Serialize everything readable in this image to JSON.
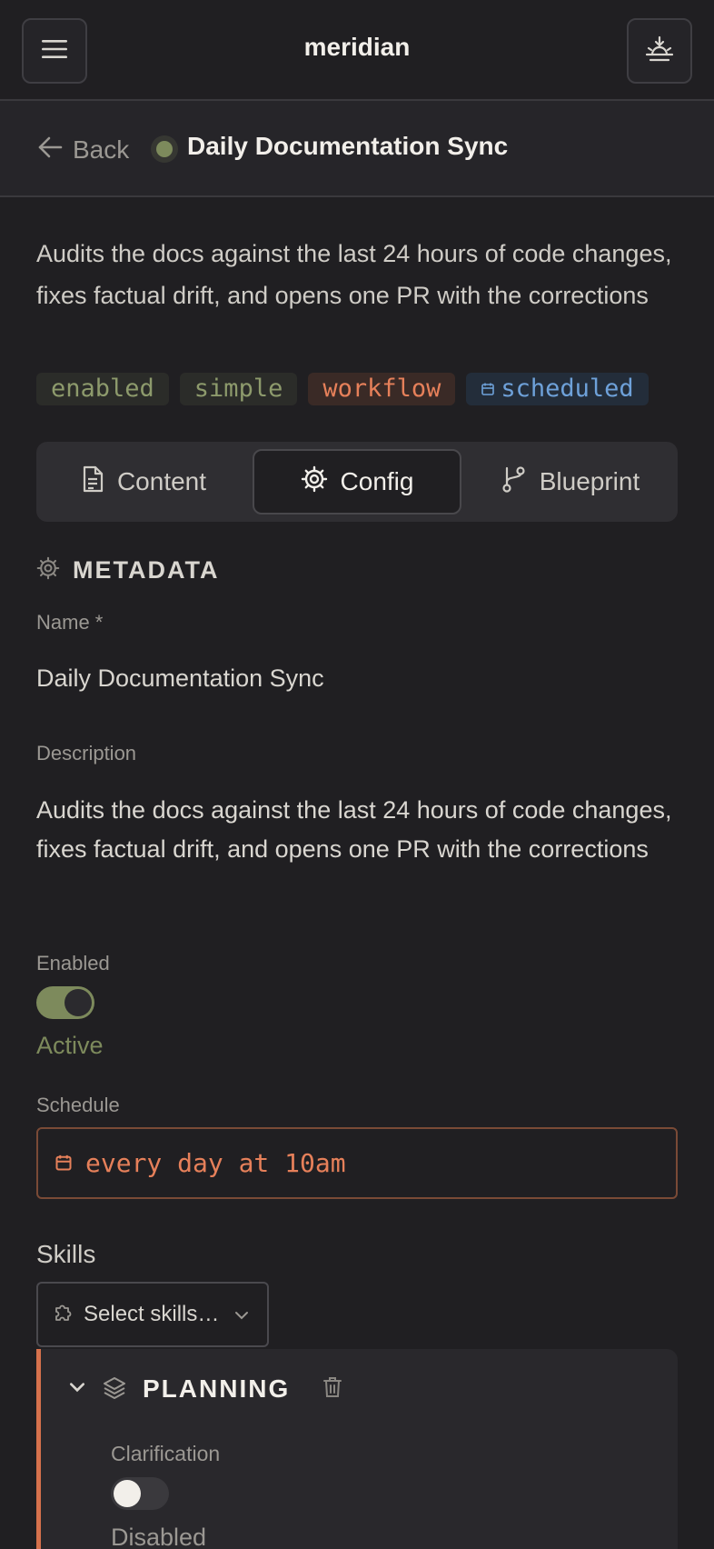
{
  "app": {
    "title": "meridian"
  },
  "header": {
    "back_label": "Back",
    "title": "Daily Documentation Sync"
  },
  "description": "Audits the docs against the last 24 hours of code changes, fixes factual drift, and opens one PR with the corrections",
  "tags": [
    "enabled",
    "simple",
    "workflow",
    "scheduled"
  ],
  "tabs": [
    {
      "label": "Content",
      "icon": "document-icon"
    },
    {
      "label": "Config",
      "icon": "gear-icon"
    },
    {
      "label": "Blueprint",
      "icon": "branch-icon"
    }
  ],
  "metadata": {
    "section_title": "METADATA",
    "name_label": "Name *",
    "name_value": "Daily Documentation Sync",
    "description_label": "Description",
    "description_value": "Audits the docs against the last 24 hours of code changes, fixes factual drift, and opens one PR with the corrections",
    "enabled_label": "Enabled",
    "enabled_status": "Active",
    "schedule_label": "Schedule",
    "schedule_value": "every day at 10am",
    "skills_label": "Skills",
    "skills_placeholder": "Select skills…"
  },
  "planning": {
    "title": "PLANNING",
    "clarification_label": "Clarification",
    "clarification_status": "Disabled"
  },
  "colors": {
    "accent_orange": "#e6805a",
    "accent_green": "#7d8a5c",
    "accent_blue": "#6ea1d9",
    "background": "#201f22"
  }
}
